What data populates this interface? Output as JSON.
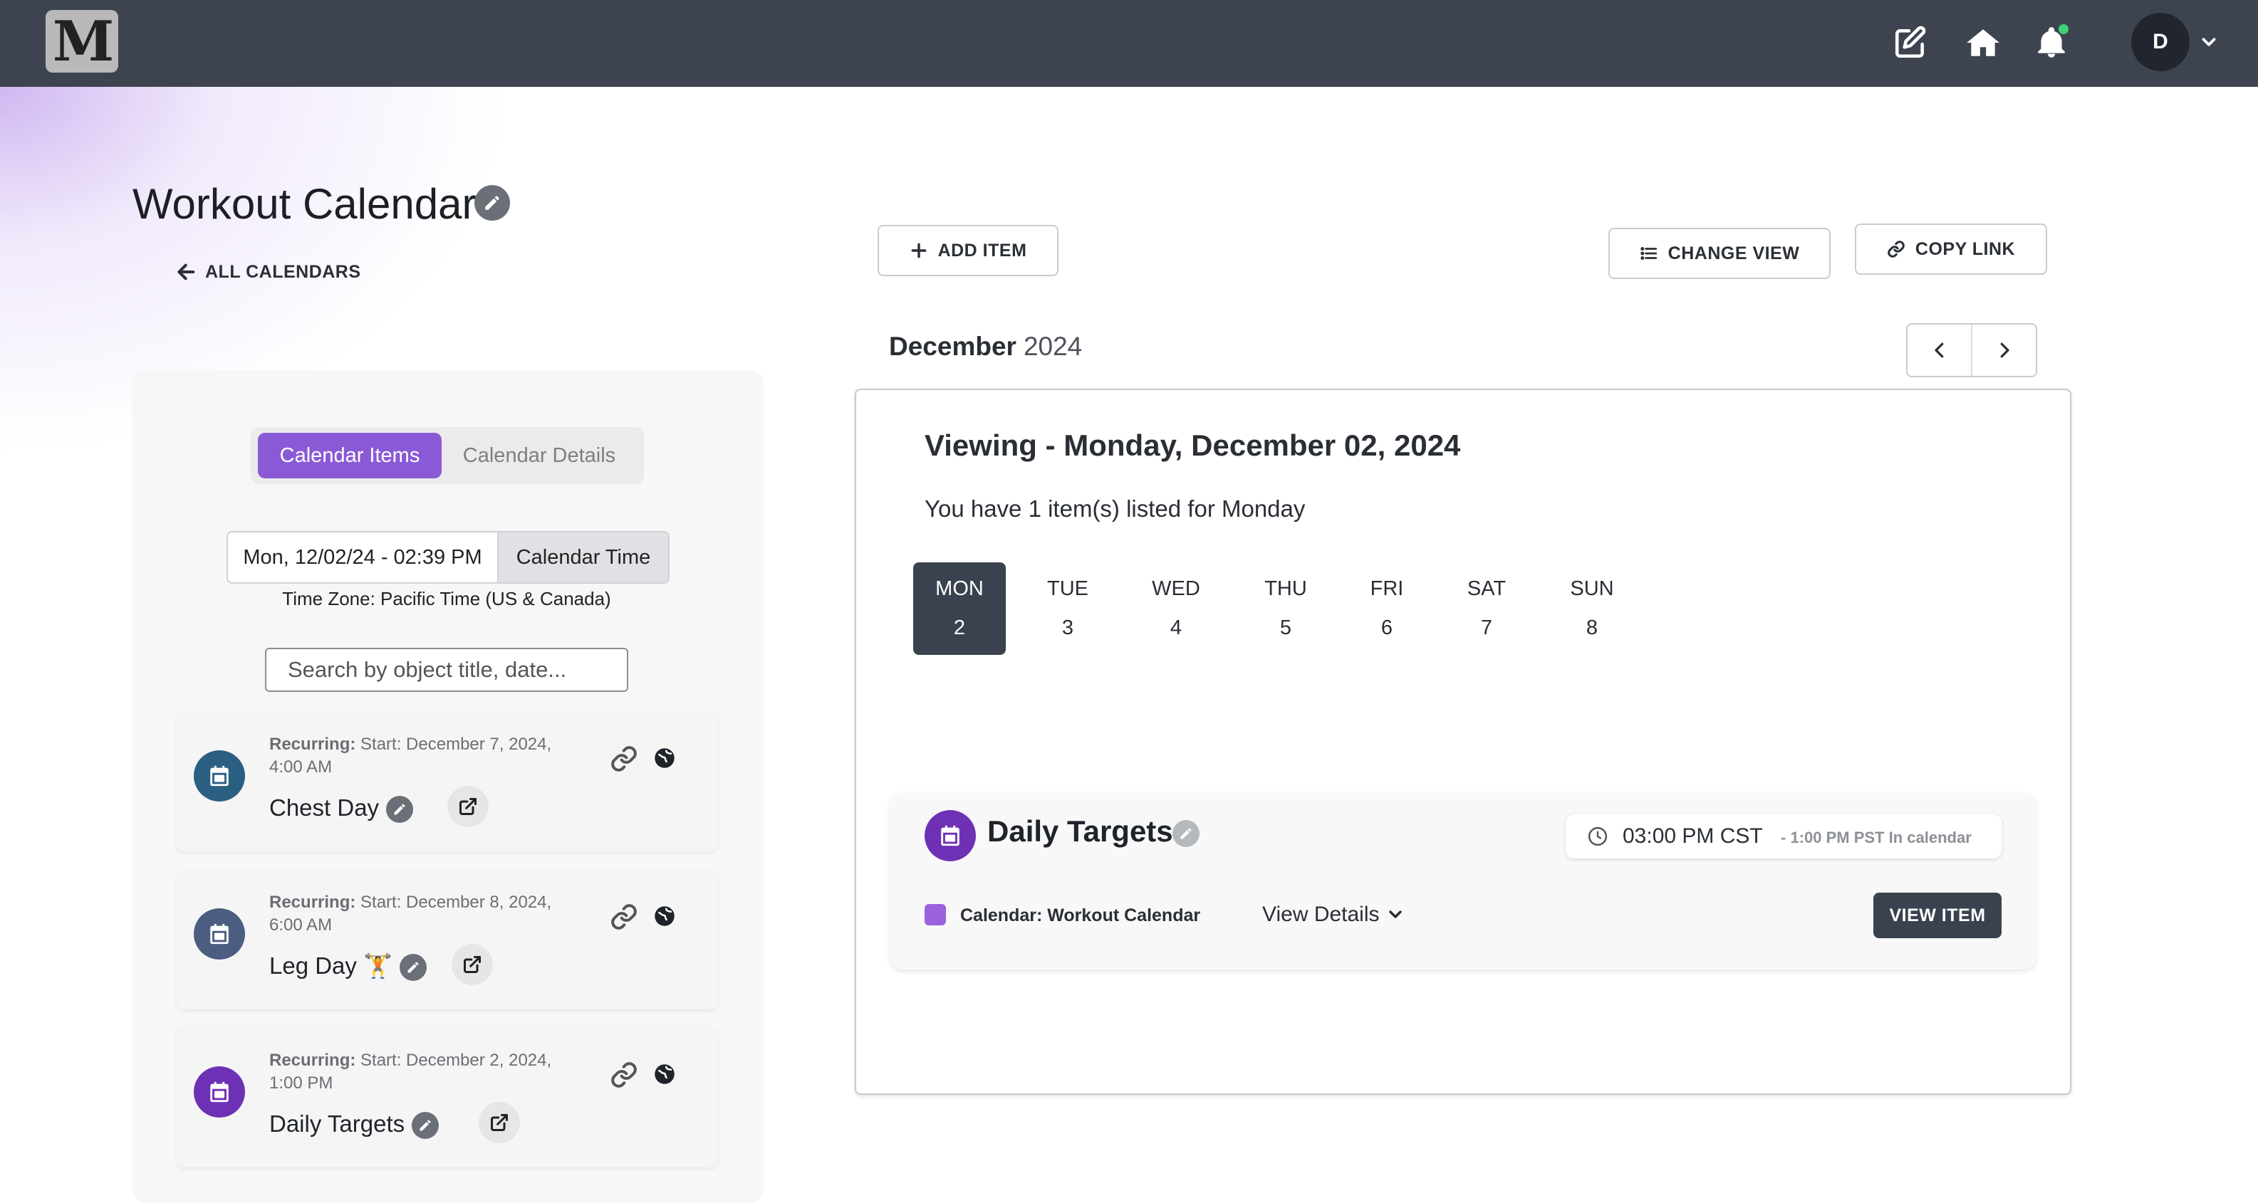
{
  "app": {
    "logo_text": "M",
    "avatar_initial": "D"
  },
  "page": {
    "title": "Workout Calendar",
    "back_label": "ALL CALENDARS"
  },
  "sidebar": {
    "tabs": [
      {
        "label": "Calendar Items",
        "active": true
      },
      {
        "label": "Calendar Details",
        "active": false
      }
    ],
    "datetime_value": "Mon, 12/02/24 - 02:39 PM",
    "datetime_mode": "Calendar Time",
    "timezone": "Time Zone: Pacific Time (US & Canada)",
    "search_placeholder": "Search by object title, date...",
    "items": [
      {
        "recurring_label": "Recurring:",
        "schedule": " Start: December 7, 2024, 4:00 AM",
        "name": "Chest Day",
        "icon_color": "#2a5f82"
      },
      {
        "recurring_label": "Recurring:",
        "schedule": " Start: December 8, 2024, 6:00 AM",
        "name": "Leg Day 🏋",
        "icon_color": "#4c5d82"
      },
      {
        "recurring_label": "Recurring:",
        "schedule": " Start: December 2, 2024, 1:00 PM",
        "name": "Daily Targets",
        "icon_color": "#6e31b5"
      }
    ]
  },
  "toolbar": {
    "add_item": "ADD ITEM",
    "change_view": "CHANGE VIEW",
    "copy_link": "COPY LINK"
  },
  "calendar": {
    "month": "December",
    "year": "2024",
    "viewing": "Viewing - Monday, December 02, 2024",
    "count_text": "You have 1 item(s) listed for Monday",
    "days": [
      {
        "dow": "MON",
        "num": "2",
        "active": true
      },
      {
        "dow": "TUE",
        "num": "3",
        "active": false
      },
      {
        "dow": "WED",
        "num": "4",
        "active": false
      },
      {
        "dow": "THU",
        "num": "5",
        "active": false
      },
      {
        "dow": "FRI",
        "num": "6",
        "active": false
      },
      {
        "dow": "SAT",
        "num": "7",
        "active": false
      },
      {
        "dow": "SUN",
        "num": "8",
        "active": false
      }
    ]
  },
  "event": {
    "title": "Daily Targets",
    "time": "03:00 PM CST",
    "time_note": "- 1:00 PM PST In calendar",
    "calendar_label": "Calendar: Workout Calendar",
    "view_details": "View Details",
    "view_item": "VIEW ITEM",
    "accent": "#6e31b5",
    "swatch": "#9a62dc"
  }
}
